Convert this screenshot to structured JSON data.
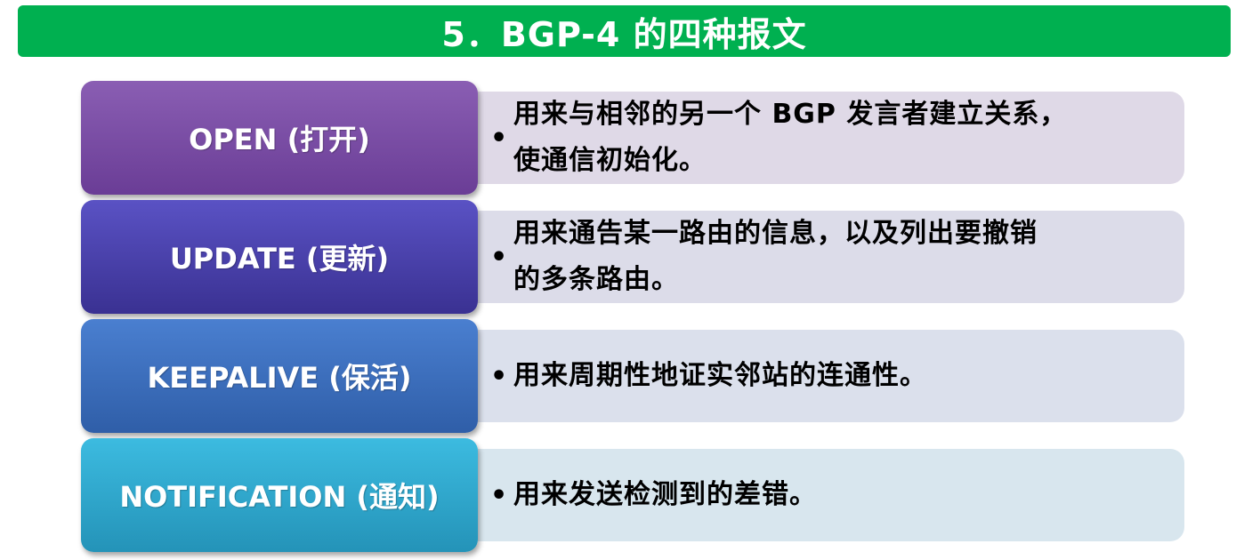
{
  "title": "5．BGP-4 的四种报文",
  "colors": {
    "title_bar": "#00b050",
    "open": "#7a4da6",
    "update": "#4a42b0",
    "keepalive": "#3f70c0",
    "notification": "#30a8cc"
  },
  "messages": [
    {
      "label": "OPEN (打开)",
      "bullet": "•",
      "description_lines": [
        "用来与相邻的另一个 BGP 发言者建立关系，",
        "使通信初始化。"
      ]
    },
    {
      "label": "UPDATE (更新)",
      "bullet": "•",
      "description_lines": [
        "用来通告某一路由的信息，以及列出要撤销",
        "的多条路由。"
      ]
    },
    {
      "label": "KEEPALIVE (保活)",
      "bullet": "•",
      "description_lines": [
        "用来周期性地证实邻站的连通性。"
      ]
    },
    {
      "label": "NOTIFICATION (通知)",
      "bullet": "•",
      "description_lines": [
        "用来发送检测到的差错。"
      ]
    }
  ]
}
